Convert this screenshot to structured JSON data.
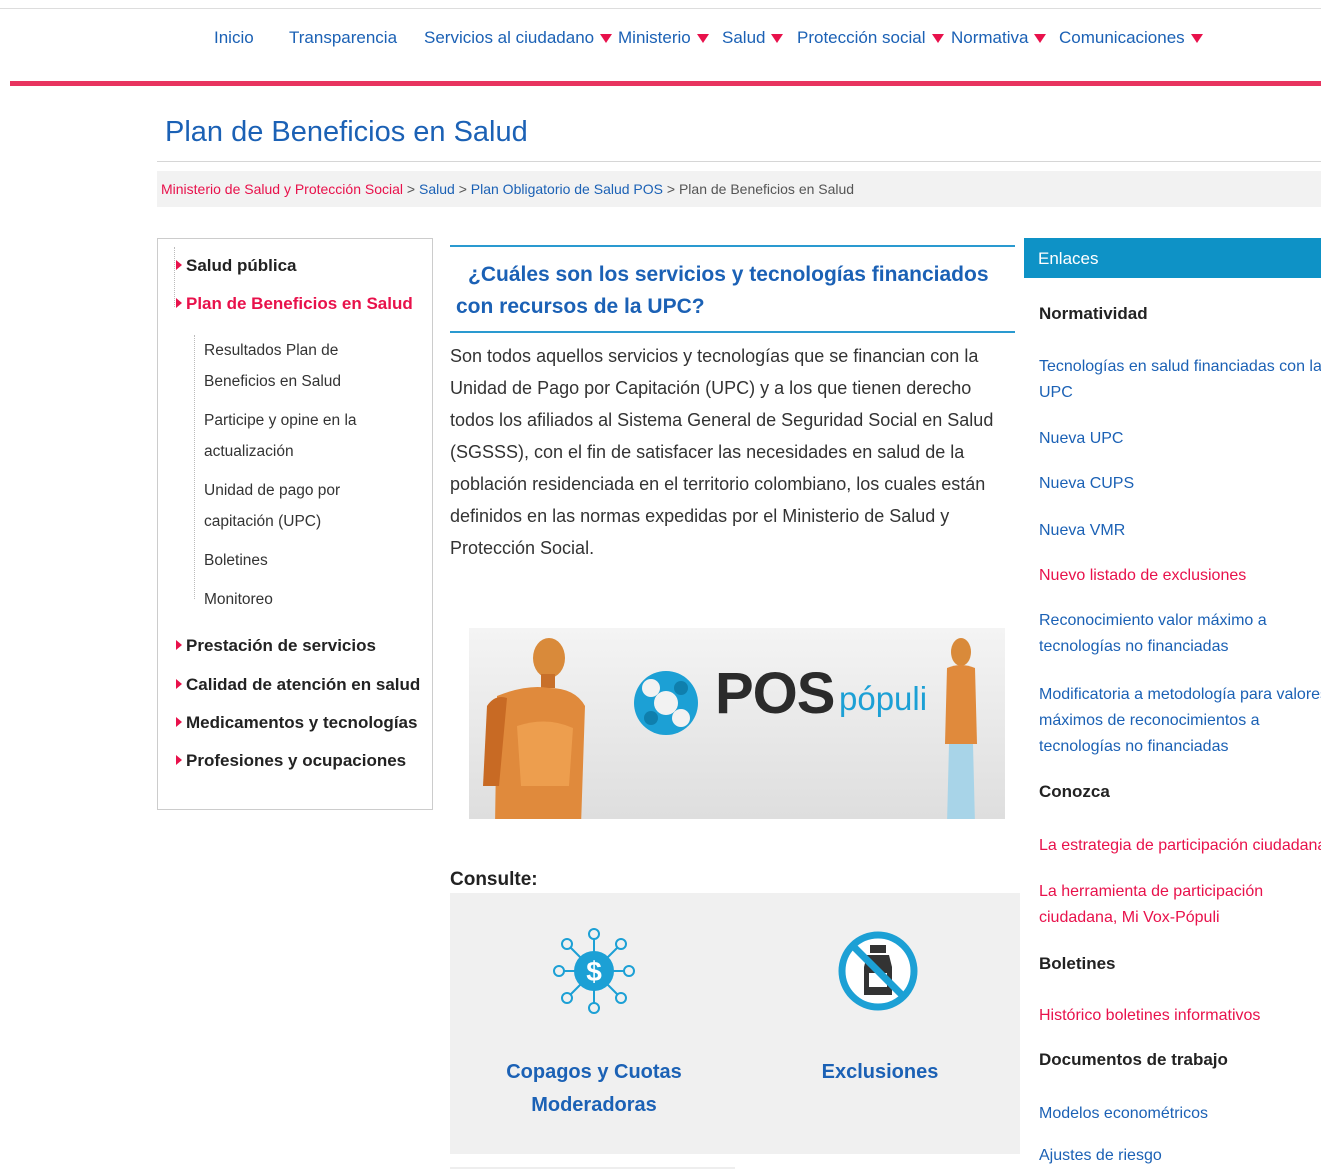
{
  "nav": {
    "items": [
      {
        "label": "Inicio",
        "dropdown": false
      },
      {
        "label": "Transparencia",
        "dropdown": false
      },
      {
        "label": "Servicios al ciudadano",
        "dropdown": true
      },
      {
        "label": "Ministerio",
        "dropdown": true
      },
      {
        "label": "Salud",
        "dropdown": true
      },
      {
        "label": "Protección social",
        "dropdown": true
      },
      {
        "label": "Normativa",
        "dropdown": true
      },
      {
        "label": "Comunicaciones",
        "dropdown": true
      }
    ]
  },
  "page": {
    "title": "Plan de Beneficios en Salud"
  },
  "breadcrumb": {
    "items": [
      "Ministerio de Salud y Protección Social",
      "Salud",
      "Plan Obligatorio de Salud POS",
      "Plan de Beneficios en Salud"
    ],
    "separator": ">"
  },
  "sidebar": {
    "top": [
      {
        "label": "Salud pública"
      },
      {
        "label": "Plan de Beneficios en Salud"
      },
      {
        "label": "Prestación de servicios"
      },
      {
        "label": "Calidad de atención en salud"
      },
      {
        "label": "Medicamentos y tecnologías"
      },
      {
        "label": "Profesiones y ocupaciones"
      }
    ],
    "sub": [
      {
        "label": "Resultados Plan de Beneficios en Salud"
      },
      {
        "label": "Participe y opine en la actualización"
      },
      {
        "label": "Unidad de pago por capitación (UPC)"
      },
      {
        "label": "Boletines"
      },
      {
        "label": "Monitoreo"
      }
    ]
  },
  "main": {
    "heading": "¿Cuáles son los servicios y tecnologías financiados con recursos de la UPC?",
    "body": "Son todos aquellos servicios y tecnologías que se financian con la Unidad de Pago por Capitación (UPC) y a los que tienen derecho todos los afiliados al Sistema General de Seguridad Social en Salud (SGSSS), con el fin de satisfacer las necesidades en salud de la población residenciada en el territorio colombiano, los cuales están definidos en las normas expedidas por el Ministerio de Salud y Protección Social.",
    "banner": {
      "brand": "POS",
      "brand_sub": "pópuli"
    },
    "consulte_label": "Consulte:",
    "cards": [
      {
        "label": "Copagos y Cuotas Moderadoras",
        "icon": "money-network-icon"
      },
      {
        "label": "Exclusiones",
        "icon": "no-medication-icon"
      }
    ]
  },
  "right": {
    "header": "Enlaces",
    "sections": [
      {
        "title": "Normatividad"
      },
      {
        "title": "Conozca"
      },
      {
        "title": "Boletines"
      },
      {
        "title": "Documentos de trabajo"
      }
    ],
    "links": [
      {
        "label": "Tecnologías en salud financiadas con la UPC"
      },
      {
        "label": "Nueva UPC"
      },
      {
        "label": "Nueva CUPS"
      },
      {
        "label": "Nueva VMR"
      },
      {
        "label": "Nuevo listado de exclusiones"
      },
      {
        "label": "Reconocimiento valor máximo a tecnologías no financiadas"
      },
      {
        "label": "Modificatoria a metodología para valores máximos de reconocimientos a tecnologías no financiadas"
      },
      {
        "label": "La estrategia de participación ciudadana"
      },
      {
        "label": "La herramienta de participación ciudadana, Mi Vox-Pópuli"
      },
      {
        "label": "Histórico boletines informativos"
      },
      {
        "label": "Modelos econométricos"
      },
      {
        "label": "Ajustes de riesgo"
      }
    ]
  },
  "colors": {
    "pink": "#e8345f",
    "blue": "#1b61b5",
    "cyan": "#0e92c6",
    "red_link": "#e8114b"
  }
}
